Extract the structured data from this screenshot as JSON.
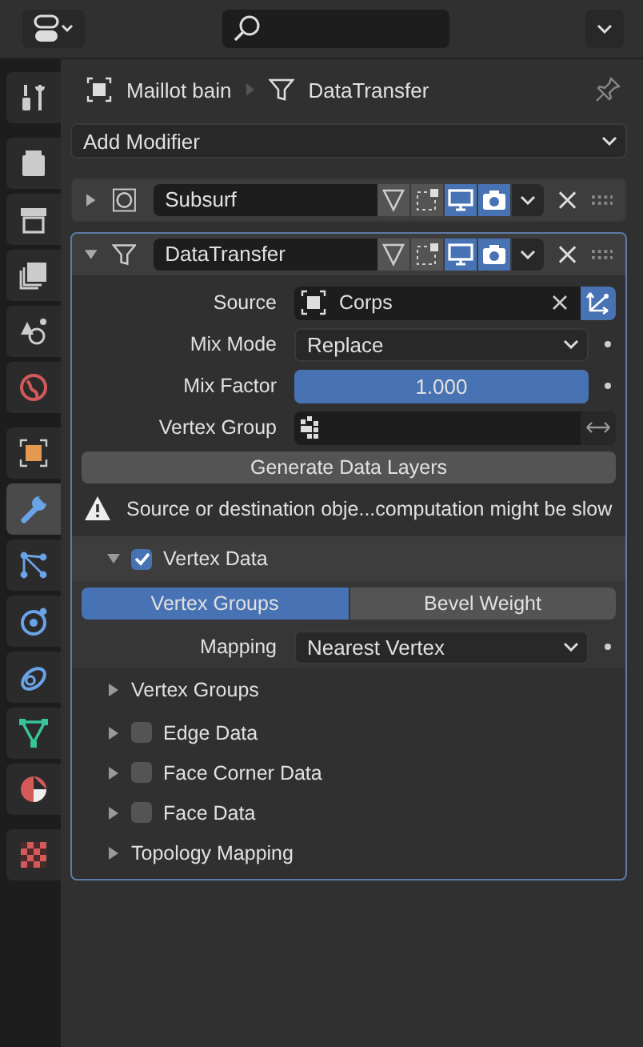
{
  "sidebar": {
    "groups": [
      {
        "tabs": [
          {
            "kind": "tool",
            "selected": false
          }
        ]
      },
      {
        "tabs": [
          {
            "kind": "render",
            "selected": false
          },
          {
            "kind": "output",
            "selected": false
          },
          {
            "kind": "view_layer",
            "selected": false
          },
          {
            "kind": "scene",
            "selected": false
          },
          {
            "kind": "world",
            "selected": false
          }
        ]
      },
      {
        "tabs": [
          {
            "kind": "object",
            "selected": false
          },
          {
            "kind": "modifier",
            "selected": true
          },
          {
            "kind": "particles",
            "selected": false
          },
          {
            "kind": "physics",
            "selected": false
          },
          {
            "kind": "constraints",
            "selected": false
          },
          {
            "kind": "data",
            "selected": false
          },
          {
            "kind": "material",
            "selected": false
          }
        ]
      },
      {
        "tabs": [
          {
            "kind": "texture",
            "selected": false
          }
        ]
      }
    ]
  },
  "breadcrumb": {
    "object": "Maillot bain",
    "modifier": "DataTransfer"
  },
  "add_modifier": "Add Modifier",
  "modifiers": [
    {
      "name": "Subsurf",
      "kind": "subsurf",
      "expanded": false,
      "active": false,
      "edit_mode": false,
      "on_cage": false,
      "viewport": true,
      "render": true
    },
    {
      "name": "DataTransfer",
      "kind": "datatransfer",
      "expanded": true,
      "active": true,
      "edit_mode": false,
      "on_cage": false,
      "viewport": true,
      "render": true
    }
  ],
  "datatransfer": {
    "properties": [
      {
        "kind": "object",
        "label": "Source",
        "value": "Corps",
        "object_transform": true
      },
      {
        "kind": "dropdown",
        "label": "Mix Mode",
        "value": "Replace"
      },
      {
        "kind": "slider",
        "label": "Mix Factor",
        "value": "1.000",
        "level": 1
      },
      {
        "kind": "vertex_group",
        "label": "Vertex Group"
      }
    ],
    "generate_button": "Generate Data Layers",
    "warning": "Source or destination obje...computation might be slow",
    "sections": [
      {
        "kind": "check",
        "label": "Vertex Data",
        "expanded": true,
        "checked": true,
        "tabs": [
          {
            "label": "Vertex Groups",
            "selected": true
          },
          {
            "label": "Bevel Weight",
            "selected": false
          }
        ],
        "mapping": {
          "label": "Mapping",
          "value": "Nearest Vertex"
        },
        "children": [
          {
            "kind": "plain",
            "label": "Vertex Groups",
            "expanded": false
          }
        ]
      },
      {
        "kind": "check",
        "label": "Edge Data",
        "expanded": false,
        "checked": false
      },
      {
        "kind": "check",
        "label": "Face Corner Data",
        "expanded": false,
        "checked": false
      },
      {
        "kind": "check",
        "label": "Face Data",
        "expanded": false,
        "checked": false
      },
      {
        "kind": "plain",
        "label": "Topology Mapping",
        "expanded": false
      }
    ]
  }
}
